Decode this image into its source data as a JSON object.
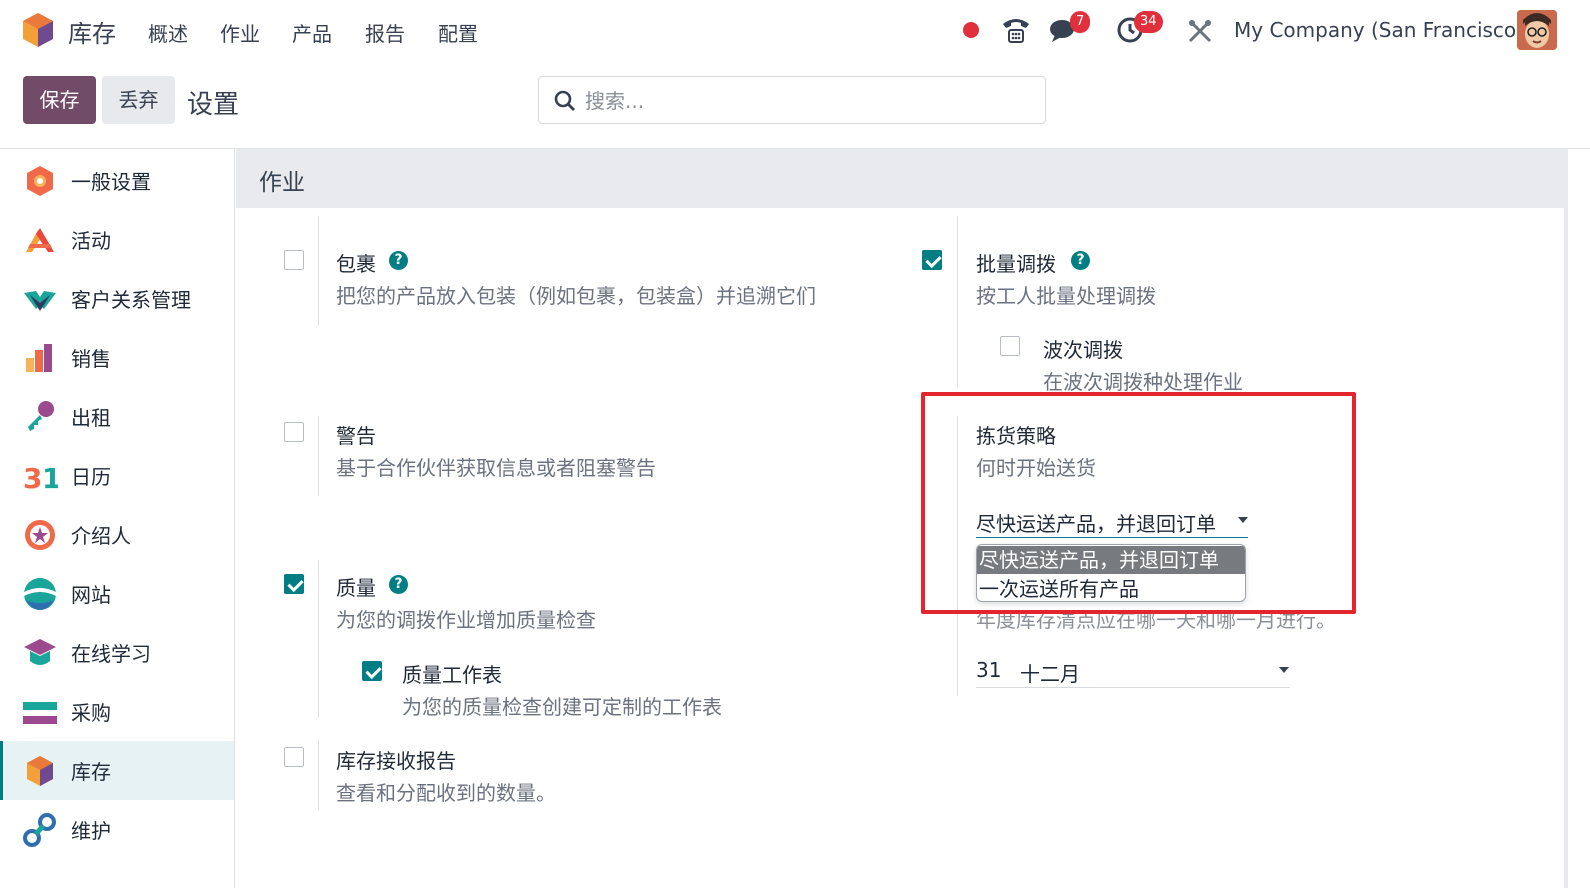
{
  "topbar": {
    "app_name": "库存",
    "menu": [
      "概述",
      "作业",
      "产品",
      "报告",
      "配置"
    ],
    "messages_count": "7",
    "activities_count": "34",
    "company": "My Company (San Francisco)"
  },
  "controlbar": {
    "save_label": "保存",
    "discard_label": "丢弃",
    "title": "设置",
    "search_placeholder": "搜索..."
  },
  "sidebar": {
    "items": [
      {
        "label": "一般设置",
        "icon": "general-settings-icon"
      },
      {
        "label": "活动",
        "icon": "activity-icon"
      },
      {
        "label": "客户关系管理",
        "icon": "crm-icon"
      },
      {
        "label": "销售",
        "icon": "sales-icon"
      },
      {
        "label": "出租",
        "icon": "rental-icon"
      },
      {
        "label": "日历",
        "icon": "calendar-icon"
      },
      {
        "label": "介绍人",
        "icon": "referral-icon"
      },
      {
        "label": "网站",
        "icon": "website-icon"
      },
      {
        "label": "在线学习",
        "icon": "elearning-icon"
      },
      {
        "label": "采购",
        "icon": "purchase-icon"
      },
      {
        "label": "库存",
        "icon": "inventory-icon",
        "active": true
      },
      {
        "label": "维护",
        "icon": "maintenance-icon"
      }
    ]
  },
  "section": {
    "title": "作业",
    "left": [
      {
        "title": "包裹",
        "desc": "把您的产品放入包装（例如包裹，包装盒）并追溯它们",
        "checked": false,
        "help": true
      },
      {
        "title": "警告",
        "desc": "基于合作伙伴获取信息或者阻塞警告",
        "checked": false,
        "help": false
      },
      {
        "title": "质量",
        "desc": "为您的调拨作业增加质量检查",
        "checked": true,
        "help": true,
        "sub": {
          "title": "质量工作表",
          "desc": "为您的质量检查创建可定制的工作表",
          "checked": true
        }
      },
      {
        "title": "库存接收报告",
        "desc": "查看和分配收到的数量。",
        "checked": false,
        "help": false
      }
    ],
    "right": {
      "batch": {
        "title": "批量调拨",
        "desc": "按工人批量处理调拨",
        "checked": true,
        "sub": {
          "title": "波次调拨",
          "desc": "在波次调拨种处理作业",
          "checked": false
        }
      },
      "picking": {
        "title": "拣货策略",
        "desc": "何时开始送货",
        "selected": "尽快运送产品，并退回订单",
        "options": [
          "尽快运送产品，并退回订单",
          "一次运送所有产品"
        ]
      },
      "inventory_date": {
        "desc_partial": "年度库存清点应在哪一天和哪一月进行。",
        "day": "31",
        "month": "十二月"
      }
    }
  },
  "colors": {
    "brand": "#714B67",
    "accent": "#017e84",
    "highlight": "#e3262d"
  }
}
